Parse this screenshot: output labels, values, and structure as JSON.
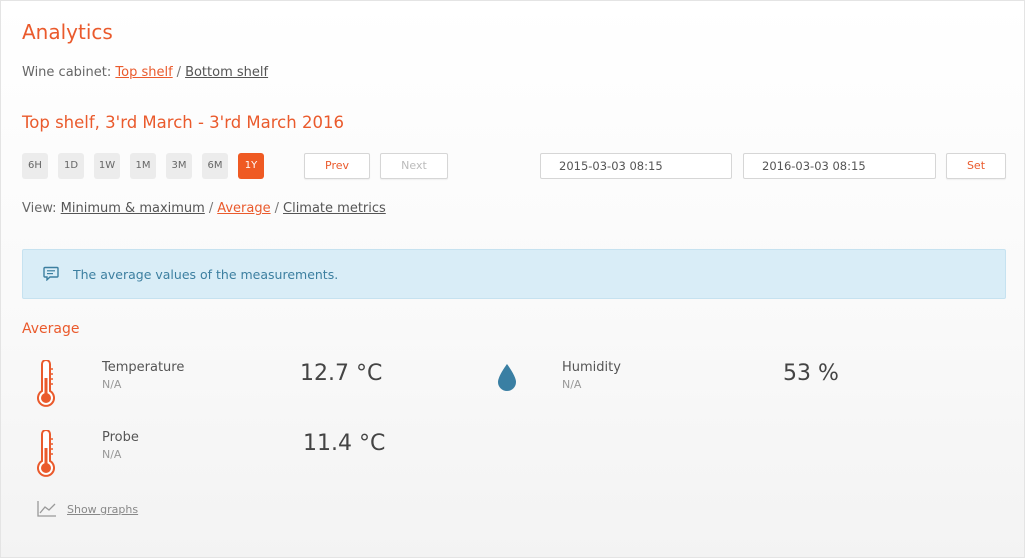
{
  "page": {
    "title": "Analytics"
  },
  "cabinet": {
    "label": "Wine cabinet:",
    "separator": "/",
    "shelves": [
      {
        "label": "Top shelf",
        "active": true
      },
      {
        "label": "Bottom shelf",
        "active": false
      }
    ]
  },
  "period_title": "Top shelf, 3'rd March - 3'rd March 2016",
  "ranges": [
    {
      "label": "6H",
      "active": false
    },
    {
      "label": "1D",
      "active": false
    },
    {
      "label": "1W",
      "active": false
    },
    {
      "label": "1M",
      "active": false
    },
    {
      "label": "3M",
      "active": false
    },
    {
      "label": "6M",
      "active": false
    },
    {
      "label": "1Y",
      "active": true
    }
  ],
  "nav": {
    "prev": "Prev",
    "next": "Next",
    "set": "Set"
  },
  "dates": {
    "from": "2015-03-03 08:15",
    "to": "2016-03-03 08:15"
  },
  "view": {
    "label": "View:",
    "separator": "/",
    "options": [
      {
        "label": "Minimum & maximum",
        "active": false
      },
      {
        "label": "Average",
        "active": true
      },
      {
        "label": "Climate metrics",
        "active": false
      }
    ]
  },
  "info": {
    "text": "The average values of the measurements.",
    "icon": "comment-icon"
  },
  "section_title": "Average",
  "metrics": [
    {
      "name": "Temperature",
      "sub": "N/A",
      "value": "12.7 °C",
      "icon": "thermometer-icon"
    },
    {
      "name": "Humidity",
      "sub": "N/A",
      "value": "53 %",
      "icon": "droplet-icon"
    },
    {
      "name": "Probe",
      "sub": "N/A",
      "value": "11.4 °C",
      "icon": "thermometer-icon"
    }
  ],
  "show_graphs": {
    "label": "Show graphs",
    "icon": "line-chart-icon"
  },
  "colors": {
    "accent": "#ea5a2c",
    "info_bg": "#d9edf7",
    "info_text": "#3c7fa0",
    "droplet": "#3a7fa3"
  }
}
